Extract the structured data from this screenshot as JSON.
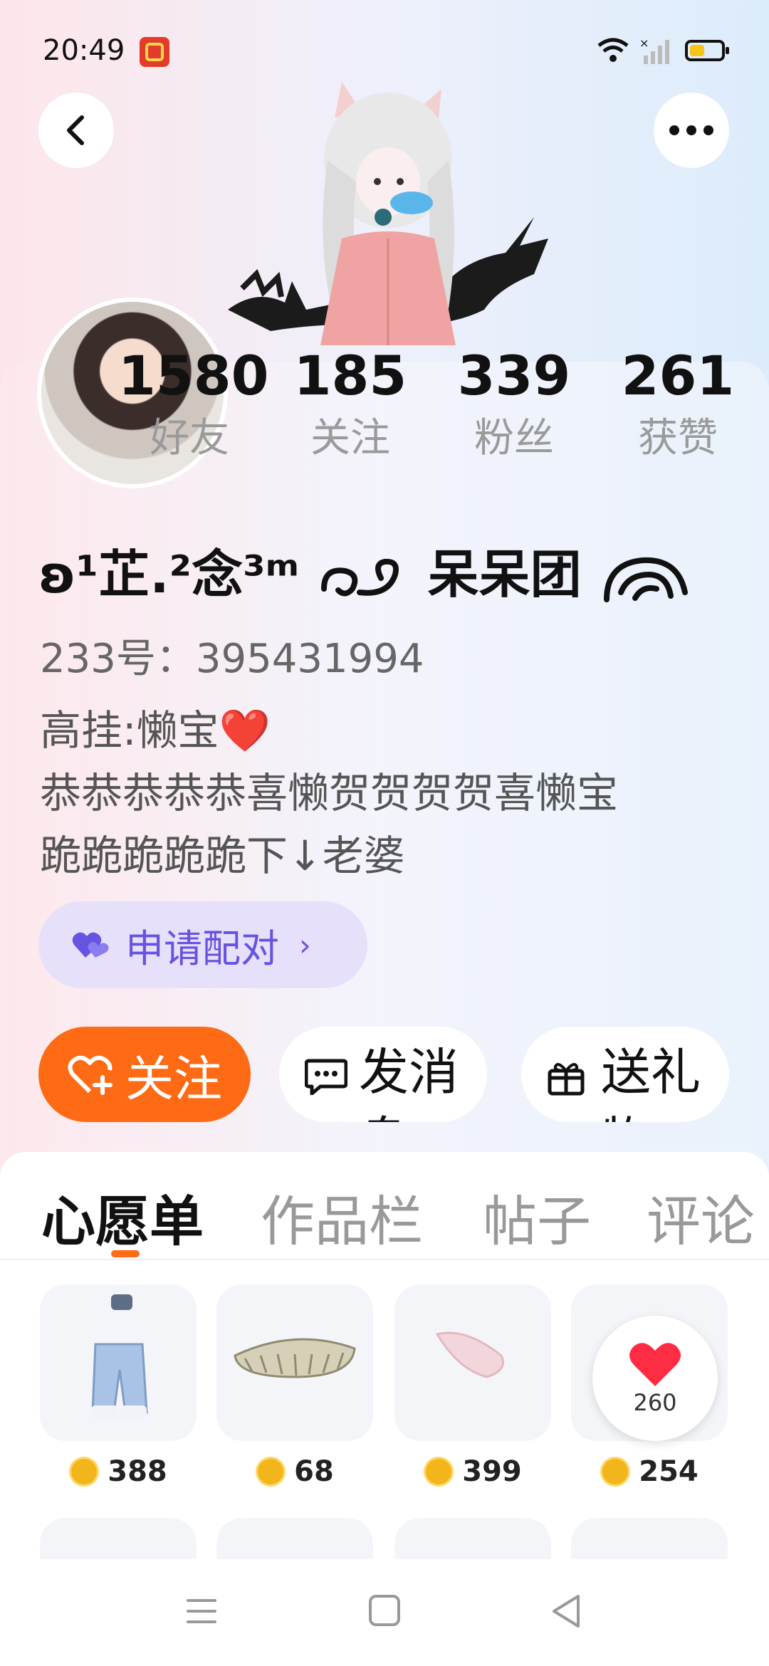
{
  "status": {
    "time": "20:49"
  },
  "profile": {
    "stats": [
      {
        "value": "1580",
        "label": "好友"
      },
      {
        "value": "185",
        "label": "关注"
      },
      {
        "value": "339",
        "label": "粉丝"
      },
      {
        "value": "261",
        "label": "获赞"
      }
    ],
    "username": "ʚ¹芷.²念³ᵐ",
    "username_suffix": "呆呆团",
    "uid": "233号：395431994",
    "bio": "高挂:懒宝❤️\n恭恭恭恭恭喜懒贺贺贺贺喜懒宝\n跪跪跪跪跪下↓老婆"
  },
  "actions": {
    "pair": "申请配对",
    "follow": "关注",
    "message": "发消息",
    "gift": "送礼物"
  },
  "tabs": [
    "心愿单",
    "作品栏",
    "帖子",
    "评论"
  ],
  "wishlist": [
    {
      "price": "388",
      "icon": "jeans-icon"
    },
    {
      "price": "68",
      "icon": "grill-teeth-icon"
    },
    {
      "price": "399",
      "icon": "feather-icon"
    },
    {
      "price": "254",
      "icon": "item-icon"
    }
  ],
  "like_bubble": {
    "count": "260"
  },
  "colors": {
    "accent": "#ff6a14",
    "pair": "#6653e0"
  }
}
